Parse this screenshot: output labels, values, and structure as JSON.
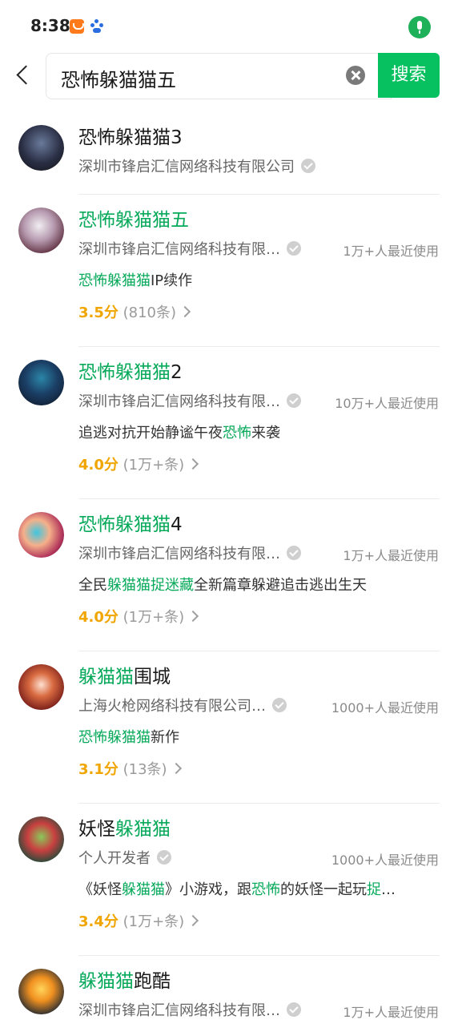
{
  "status_bar": {
    "time": "8:38"
  },
  "search": {
    "query": "恐怖躲猫猫五",
    "button_label": "搜索"
  },
  "results": [
    {
      "title": [
        {
          "t": "恐怖躲猫猫3",
          "h": false
        }
      ],
      "company": "深圳市锋启汇信网络科技有限公司",
      "usage": "",
      "desc": [],
      "score": "",
      "count": ""
    },
    {
      "title": [
        {
          "t": "恐怖躲猫猫五",
          "h": true
        }
      ],
      "company": "深圳市锋启汇信网络科技有限…",
      "usage": "1万+人最近使用",
      "desc": [
        {
          "t": "恐怖躲猫猫",
          "h": true
        },
        {
          "t": "IP续作",
          "h": false
        }
      ],
      "score": "3.5分",
      "count": "(810条)"
    },
    {
      "title": [
        {
          "t": "恐怖躲猫猫",
          "h": true
        },
        {
          "t": "2",
          "h": false
        }
      ],
      "company": "深圳市锋启汇信网络科技有限…",
      "usage": "10万+人最近使用",
      "desc": [
        {
          "t": "追逃对抗开始静谧午夜",
          "h": false
        },
        {
          "t": "恐怖",
          "h": true
        },
        {
          "t": "来袭",
          "h": false
        }
      ],
      "score": "4.0分",
      "count": "(1万+条)"
    },
    {
      "title": [
        {
          "t": "恐怖躲猫猫",
          "h": true
        },
        {
          "t": "4",
          "h": false
        }
      ],
      "company": "深圳市锋启汇信网络科技有限…",
      "usage": "1万+人最近使用",
      "desc": [
        {
          "t": "全民",
          "h": false
        },
        {
          "t": "躲猫猫捉迷藏",
          "h": true
        },
        {
          "t": "全新篇章躲避追击逃出生天",
          "h": false
        }
      ],
      "score": "4.0分",
      "count": "(1万+条)"
    },
    {
      "title": [
        {
          "t": "躲猫猫",
          "h": true
        },
        {
          "t": "围城",
          "h": false
        }
      ],
      "company": "上海火枪网络科技有限公司…",
      "usage": "1000+人最近使用",
      "desc": [
        {
          "t": "恐怖躲猫猫",
          "h": true
        },
        {
          "t": "新作",
          "h": false
        }
      ],
      "score": "3.1分",
      "count": "(13条)"
    },
    {
      "title": [
        {
          "t": "妖怪",
          "h": false
        },
        {
          "t": "躲猫猫",
          "h": true
        }
      ],
      "company": "个人开发者",
      "usage": "1000+人最近使用",
      "desc": [
        {
          "t": "《妖怪",
          "h": false
        },
        {
          "t": "躲猫猫",
          "h": true
        },
        {
          "t": "》小游戏，跟",
          "h": false
        },
        {
          "t": "恐怖",
          "h": true
        },
        {
          "t": "的妖怪一起玩",
          "h": false
        },
        {
          "t": "捉",
          "h": true
        },
        {
          "t": "…",
          "h": false
        }
      ],
      "score": "3.4分",
      "count": "(1万+条)"
    },
    {
      "title": [
        {
          "t": "躲猫猫",
          "h": true
        },
        {
          "t": "跑酷",
          "h": false
        }
      ],
      "company": "深圳市锋启汇信网络科技有限…",
      "usage": "1万+人最近使用",
      "desc": [],
      "score": "",
      "count": ""
    }
  ],
  "colors": {
    "accent": "#07c160",
    "highlight": "#07a95a",
    "score": "#f0a500"
  }
}
